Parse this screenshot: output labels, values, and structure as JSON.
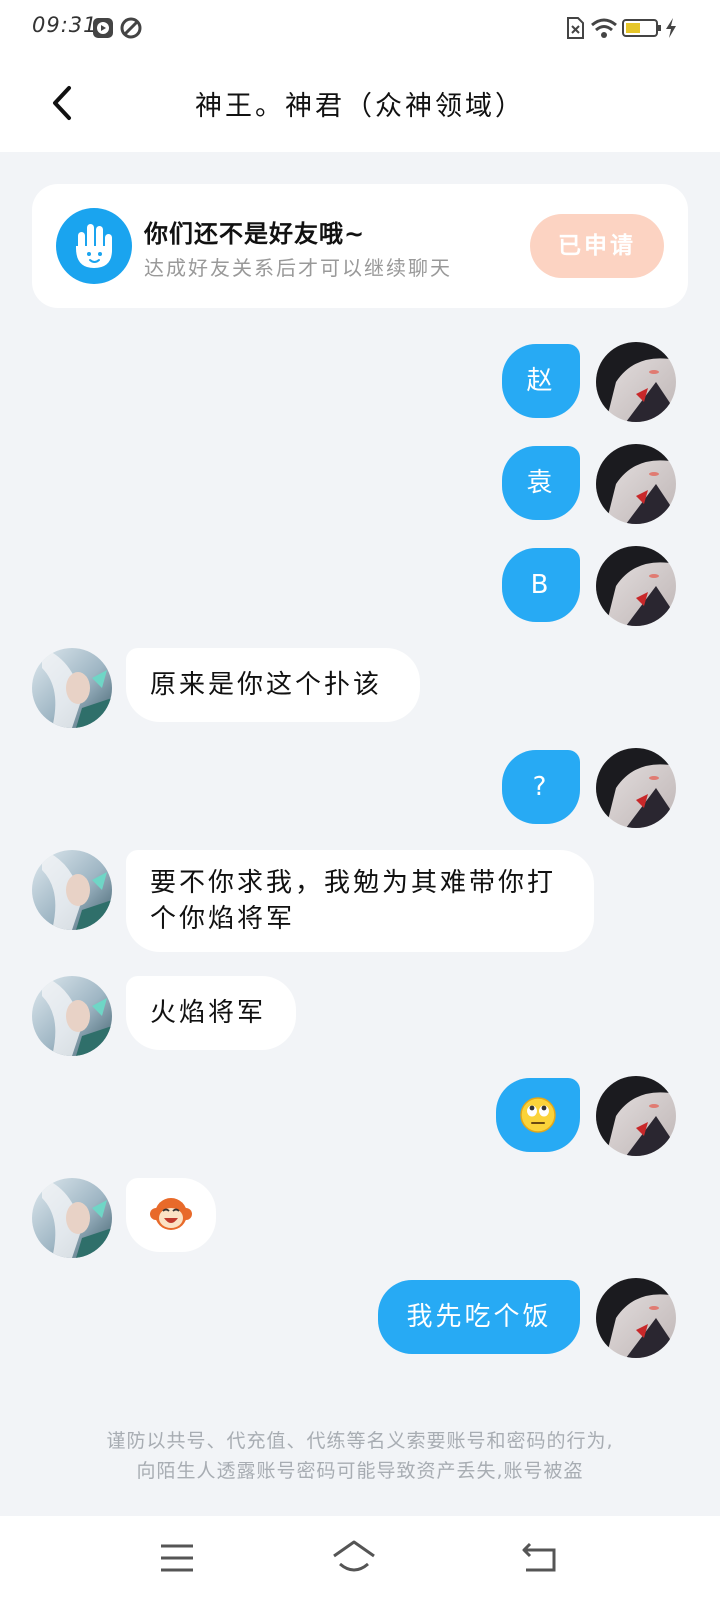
{
  "status_bar": {
    "time": "09:31",
    "icons": [
      "play-icon",
      "leaf-icon",
      "no-sim-icon",
      "wifi-icon",
      "battery-icon",
      "charging-icon"
    ]
  },
  "header": {
    "title": "神王。神君（众神领域）",
    "back_icon": "chevron-left-icon"
  },
  "friend_card": {
    "icon": "waving-hand-icon",
    "title": "你们还不是好友哦~",
    "subtitle": "达成好友关系后才可以继续聊天",
    "button_label": "已申请",
    "accent": "#1aa4ef",
    "button_color": "#fcd3c2"
  },
  "messages": [
    {
      "from": "me",
      "text": "赵"
    },
    {
      "from": "me",
      "text": "袁"
    },
    {
      "from": "me",
      "text": "B"
    },
    {
      "from": "other",
      "text": "原来是你这个扑该"
    },
    {
      "from": "me",
      "text": "?"
    },
    {
      "from": "other",
      "text": "要不你求我，我勉为其难带你打个你焰将军"
    },
    {
      "from": "other",
      "text": "火焰将军"
    },
    {
      "from": "me",
      "emoji": "eye-roll-emoji"
    },
    {
      "from": "other",
      "emoji": "laughing-monkey-emoji"
    },
    {
      "from": "me",
      "text": "我先吃个饭"
    }
  ],
  "colors": {
    "outgoing_bubble": "#27aaf4",
    "incoming_bubble": "#ffffff",
    "chat_background": "#f2f4f7"
  },
  "warning": {
    "line1": "谨防以共号、代充值、代练等名义索要账号和密码的行为,",
    "line2": "向陌生人透露账号密码可能导致资产丢失,账号被盗"
  },
  "nav_bar": {
    "icons": [
      "menu-icon",
      "home-icon",
      "back-icon"
    ]
  }
}
